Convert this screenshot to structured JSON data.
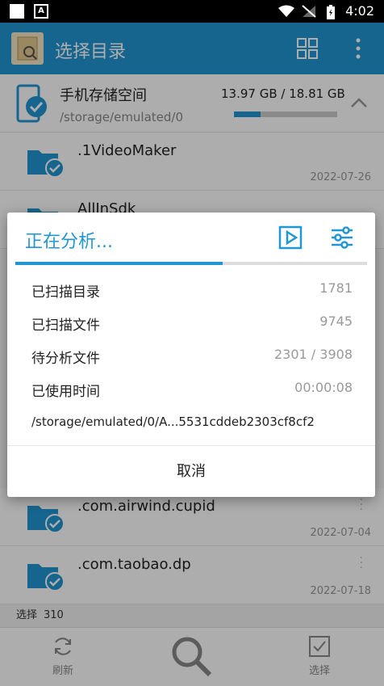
{
  "status_bar": {
    "time": "4:02",
    "notif_letter": "A"
  },
  "app_bar": {
    "title": "选择目录"
  },
  "storage": {
    "name": "手机存储空间",
    "path": "/storage/emulated/0",
    "size": "13.97 GB / 18.81 GB",
    "usage_fraction": 0.26
  },
  "files": [
    {
      "name": ".1VideoMaker",
      "date": "2022-07-26"
    },
    {
      "name": "AllInSdk",
      "date": ""
    },
    {
      "name": ".com.airwind.cupid",
      "date": "2022-07-04"
    },
    {
      "name": ".com.taobao.dp",
      "date": "2022-07-18"
    }
  ],
  "select_bar": {
    "label": "选择",
    "count": "310"
  },
  "bottom_bar": {
    "refresh": "刷新",
    "select": "选择"
  },
  "dialog": {
    "title": "正在分析...",
    "progress_fraction": 0.59,
    "stats": [
      {
        "label": "已扫描目录",
        "value": "1781"
      },
      {
        "label": "已扫描文件",
        "value": "9745"
      },
      {
        "label": "待分析文件",
        "value": "2301 / 3908"
      },
      {
        "label": "已使用时间",
        "value": "00:00:08"
      }
    ],
    "current_path": "/storage/emulated/0/A...5531cddeb2303cf8cf2",
    "cancel": "取消"
  },
  "colors": {
    "accent": "#2196d3"
  }
}
